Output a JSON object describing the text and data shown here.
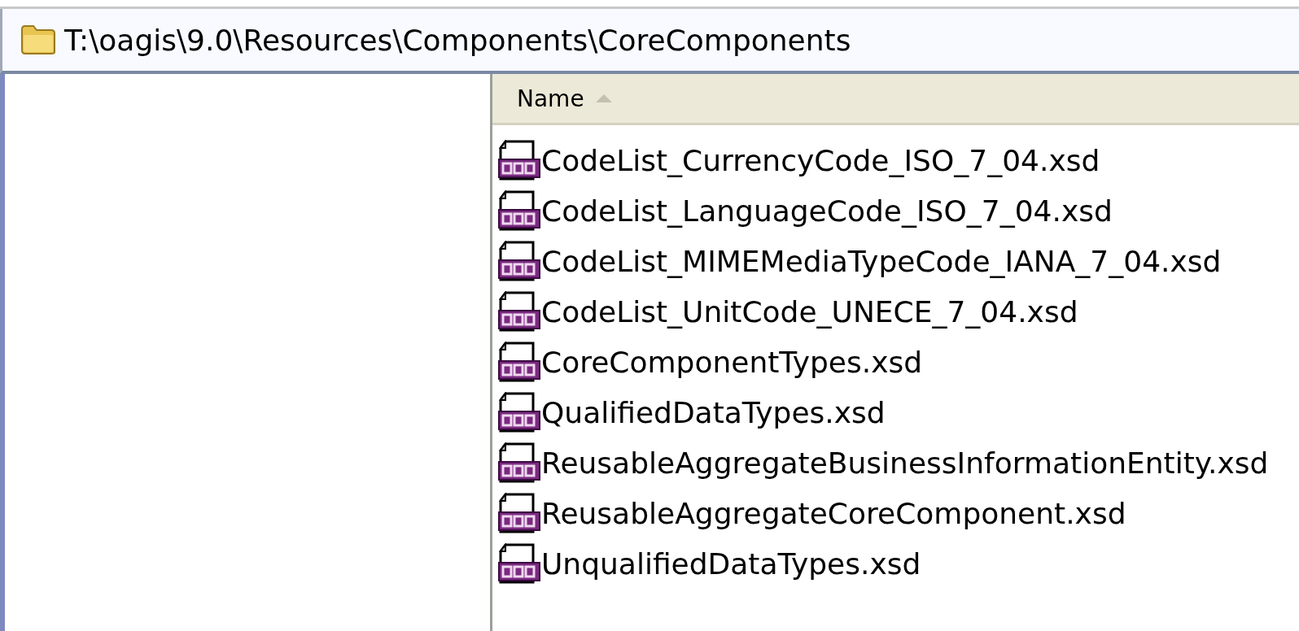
{
  "address_bar": {
    "path": "T:\\oagis\\9.0\\Resources\\Components\\CoreComponents"
  },
  "file_list": {
    "columns": [
      {
        "label": "Name",
        "sorted_ascending": true
      }
    ],
    "rows": [
      {
        "name": "CodeList_CurrencyCode_ISO_7_04.xsd"
      },
      {
        "name": "CodeList_LanguageCode_ISO_7_04.xsd"
      },
      {
        "name": "CodeList_MIMEMediaTypeCode_IANA_7_04.xsd"
      },
      {
        "name": "CodeList_UnitCode_UNECE_7_04.xsd"
      },
      {
        "name": "CoreComponentTypes.xsd"
      },
      {
        "name": "QualifiedDataTypes.xsd"
      },
      {
        "name": "ReusableAggregateBusinessInformationEntity.xsd"
      },
      {
        "name": "ReusableAggregateCoreComponent.xsd"
      },
      {
        "name": "UnqualifiedDataTypes.xsd"
      }
    ]
  }
}
